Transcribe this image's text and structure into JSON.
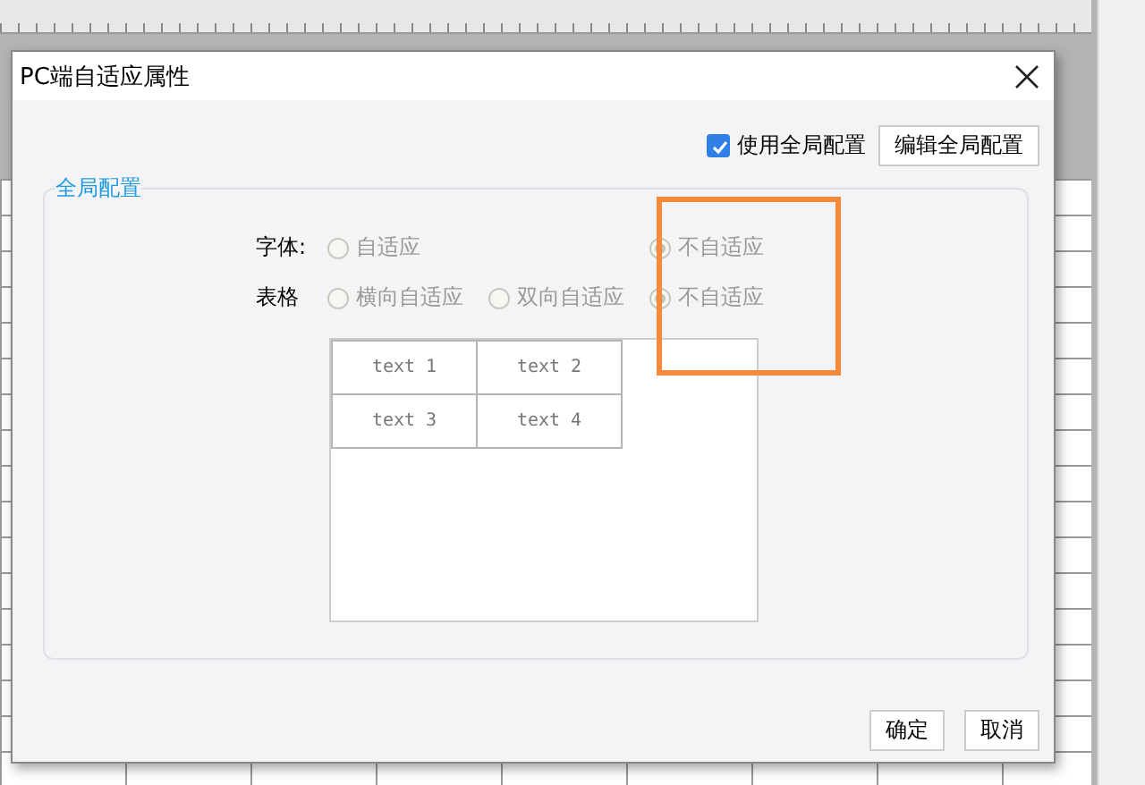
{
  "dialog": {
    "title": "PC端自适应属性",
    "use_global": {
      "label": "使用全局配置",
      "checked": true
    },
    "edit_global_button": "编辑全局配置",
    "group": {
      "legend": "全局配置",
      "rows": [
        {
          "label": "字体:",
          "options": [
            {
              "label": "自适应",
              "selected": false,
              "disabled": true
            },
            {
              "label": "不自适应",
              "selected": true,
              "disabled": true
            }
          ]
        },
        {
          "label": "表格",
          "options": [
            {
              "label": "横向自适应",
              "selected": false,
              "disabled": true
            },
            {
              "label": "双向自适应",
              "selected": false,
              "disabled": true
            },
            {
              "label": "不自适应",
              "selected": true,
              "disabled": true
            }
          ]
        }
      ],
      "preview": {
        "rows": [
          [
            "text 1",
            "text 2"
          ],
          [
            "text 3",
            "text 4"
          ]
        ]
      }
    },
    "buttons": [
      "确定",
      "取消"
    ]
  }
}
